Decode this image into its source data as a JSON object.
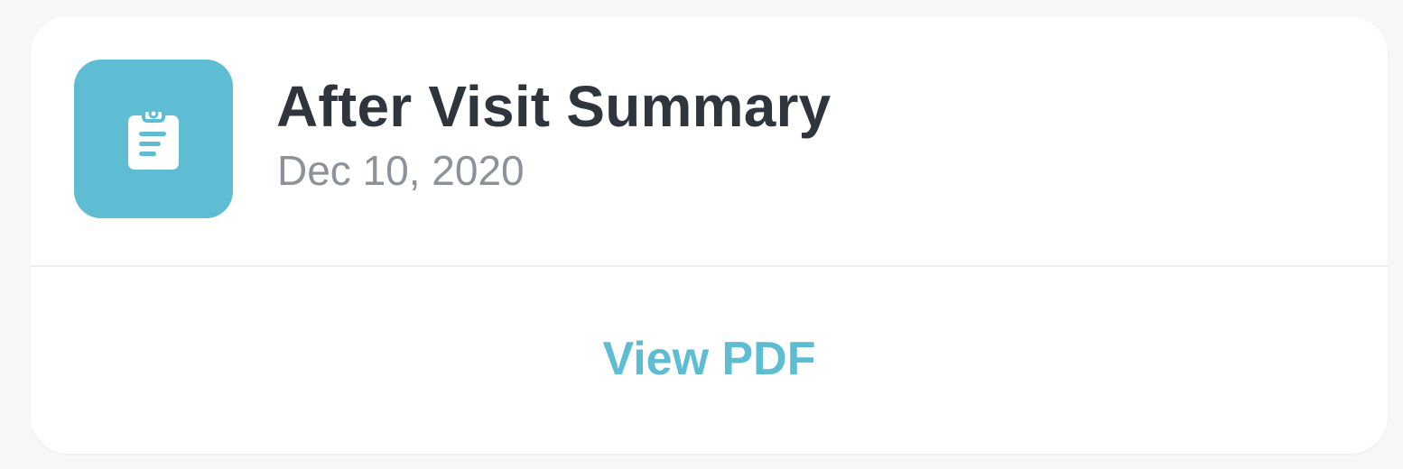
{
  "card": {
    "title": "After Visit Summary",
    "date": "Dec 10, 2020",
    "icon": "clipboard-icon",
    "action_label": "View PDF"
  },
  "colors": {
    "accent": "#5fbdd3",
    "title": "#2f353c",
    "subtitle": "#8b929a",
    "background": "#f6f7f9",
    "card": "#ffffff"
  }
}
